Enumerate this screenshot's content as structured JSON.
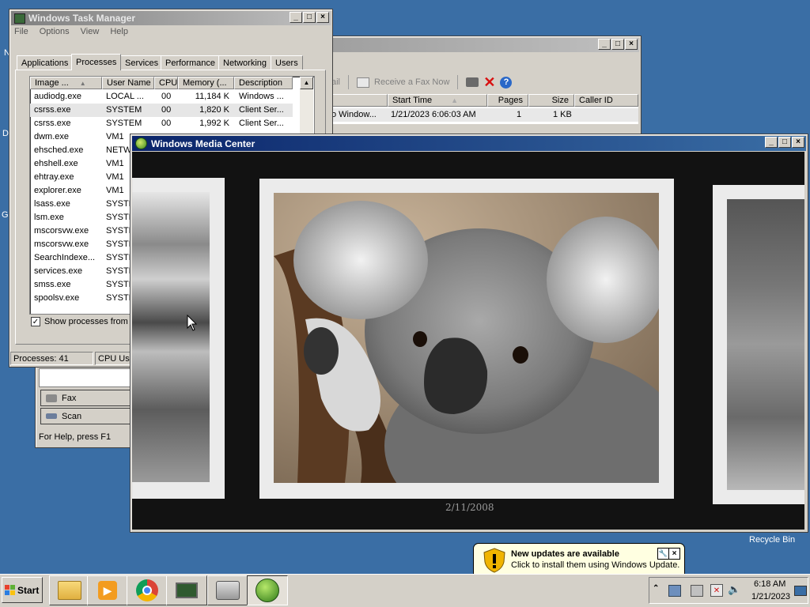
{
  "taskmgr": {
    "title": "Windows Task Manager",
    "menu": [
      "File",
      "Options",
      "View",
      "Help"
    ],
    "tabs": [
      "Applications",
      "Processes",
      "Services",
      "Performance",
      "Networking",
      "Users"
    ],
    "columns": [
      "Image ...",
      "User Name",
      "CPU",
      "Memory (...",
      "Description"
    ],
    "rows": [
      {
        "image": "audiodg.exe",
        "user": "LOCAL ...",
        "cpu": "00",
        "mem": "11,184 K",
        "desc": "Windows ..."
      },
      {
        "image": "csrss.exe",
        "user": "SYSTEM",
        "cpu": "00",
        "mem": "1,820 K",
        "desc": "Client Ser..."
      },
      {
        "image": "csrss.exe",
        "user": "SYSTEM",
        "cpu": "00",
        "mem": "1,992 K",
        "desc": "Client Ser..."
      },
      {
        "image": "dwm.exe",
        "user": "VM1",
        "cpu": "",
        "mem": "",
        "desc": ""
      },
      {
        "image": "ehsched.exe",
        "user": "NETW",
        "cpu": "",
        "mem": "",
        "desc": ""
      },
      {
        "image": "ehshell.exe",
        "user": "VM1",
        "cpu": "",
        "mem": "",
        "desc": ""
      },
      {
        "image": "ehtray.exe",
        "user": "VM1",
        "cpu": "",
        "mem": "",
        "desc": ""
      },
      {
        "image": "explorer.exe",
        "user": "VM1",
        "cpu": "",
        "mem": "",
        "desc": ""
      },
      {
        "image": "lsass.exe",
        "user": "SYSTE",
        "cpu": "",
        "mem": "",
        "desc": ""
      },
      {
        "image": "lsm.exe",
        "user": "SYSTE",
        "cpu": "",
        "mem": "",
        "desc": ""
      },
      {
        "image": "mscorsvw.exe",
        "user": "SYSTE",
        "cpu": "",
        "mem": "",
        "desc": ""
      },
      {
        "image": "mscorsvw.exe",
        "user": "SYSTE",
        "cpu": "",
        "mem": "",
        "desc": ""
      },
      {
        "image": "SearchIndexe...",
        "user": "SYSTE",
        "cpu": "",
        "mem": "",
        "desc": ""
      },
      {
        "image": "services.exe",
        "user": "SYSTE",
        "cpu": "",
        "mem": "",
        "desc": ""
      },
      {
        "image": "smss.exe",
        "user": "SYSTE",
        "cpu": "",
        "mem": "",
        "desc": ""
      },
      {
        "image": "spoolsv.exe",
        "user": "SYSTE",
        "cpu": "",
        "mem": "",
        "desc": ""
      }
    ],
    "show_all_label": "Show processes from a",
    "status_processes": "Processes: 41",
    "status_cpu": "CPU Usa"
  },
  "fax": {
    "toolbar_partial": "ail",
    "receive_label": "Receive a Fax Now",
    "columns": [
      "Start Time",
      "Pages",
      "Size",
      "Caller ID"
    ],
    "row": {
      "from": "o Window...",
      "start": "1/21/2023 6:06:03 AM",
      "pages": "1",
      "size": "1 KB"
    },
    "folders": [
      "Fax",
      "Scan"
    ],
    "status": "For Help, press F1"
  },
  "wmc": {
    "title": "Windows Media Center",
    "photo_date": "2/11/2008"
  },
  "desktop": {
    "recycle_bin": "Recycle Bin",
    "edge_letters": [
      "N",
      "D",
      "G"
    ]
  },
  "notification": {
    "title": "New updates are available",
    "body": "Click to install them using Windows Update."
  },
  "taskbar": {
    "start_label": "Start",
    "time": "6:18 AM",
    "date": "1/21/2023"
  }
}
